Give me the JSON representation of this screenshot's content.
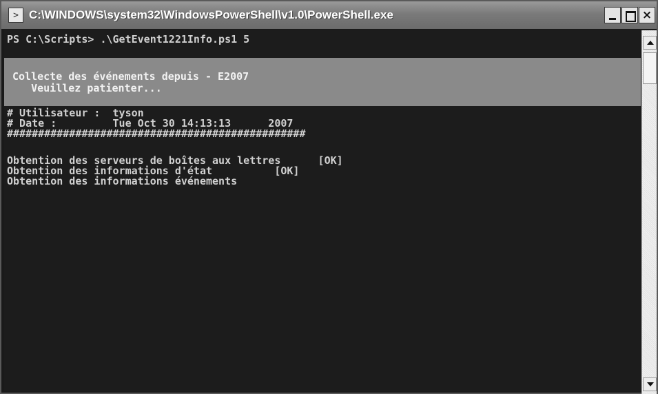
{
  "window": {
    "title": "C:\\WINDOWS\\system32\\WindowsPowerShell\\v1.0\\PowerShell.exe",
    "icon": "powershell-icon",
    "controls": {
      "minimize": "minimize-icon",
      "maximize": "maximize-icon",
      "close_glyph": "×"
    }
  },
  "console": {
    "prompt_line": "PS C:\\Scripts> .\\GetEvent1221Info.ps1 5",
    "banner": {
      "line1": "Collecte des événements depuis - E2007",
      "line2": "   Veuillez patienter..."
    },
    "info": {
      "user_line": "# Utilisateur :  tyson",
      "date_line": "# Date :         Tue Oct 30 14:13:13      2007",
      "separator": "################################################"
    },
    "steps": [
      "Obtention des serveurs de boîtes aux lettres      [OK]",
      "Obtention des informations d'état          [OK]",
      "Obtention des informations événements"
    ]
  },
  "colors": {
    "console_bg": "#1c1c1c",
    "banner_bg": "#8a8a8a",
    "text": "#d0d0d0"
  }
}
